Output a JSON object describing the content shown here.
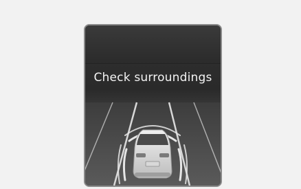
{
  "display": {
    "message": "Check surroundings"
  },
  "icons": {
    "vehicle": "car-rear-view-icon",
    "sensor_waves": "proximity-sensor-waves-icon",
    "lanes": "lane-lines-icon"
  },
  "colors": {
    "page_background": "#f2f2f2",
    "screen_dark": "#2a2a2a",
    "text": "#f4f4f4",
    "lane_lines": "#d8d8d8"
  }
}
